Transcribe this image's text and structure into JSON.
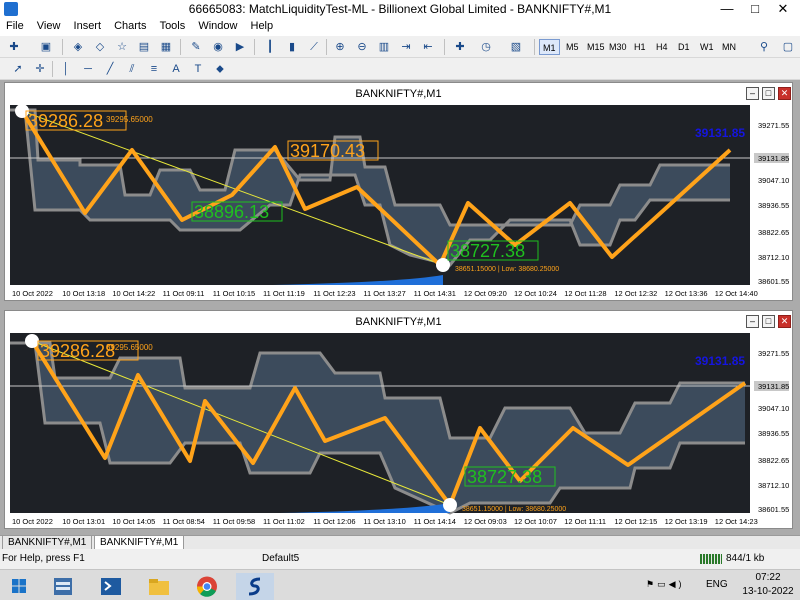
{
  "window": {
    "title": "66665083: MatchLiquidityTest-ML - Billionext Global Limited - BANKNIFTY#,M1",
    "minimize": "—",
    "maximize": "□",
    "close": "✕"
  },
  "menu": [
    "File",
    "View",
    "Insert",
    "Charts",
    "Tools",
    "Window",
    "Help"
  ],
  "timeframes": [
    "M1",
    "M5",
    "M15",
    "M30",
    "H1",
    "H4",
    "D1",
    "W1",
    "MN"
  ],
  "active_timeframe": "M1",
  "charts": [
    {
      "title": "BANKNIFTY#,M1",
      "header_info": "39295.65000",
      "current_price_label": "39131.85",
      "current_price_blue": "39131.85",
      "zigzag_labels": [
        "39286.28",
        "39170.43",
        "38896.13",
        "38727.38"
      ],
      "low_text": "38651.15000 | Low: 38680.25000",
      "y_ticks": [
        "39271.55",
        "39131.85",
        "39047.10",
        "38936.55",
        "38822.65",
        "38712.10",
        "38601.55"
      ],
      "x_ticks": [
        "10 Oct 2022",
        "10 Oct 13:18",
        "10 Oct 14:22",
        "11 Oct 09:11",
        "11 Oct 10:15",
        "11 Oct 11:19",
        "11 Oct 12:23",
        "11 Oct 13:27",
        "11 Oct 14:31",
        "12 Oct 09:20",
        "12 Oct 10:24",
        "12 Oct 11:28",
        "12 Oct 12:32",
        "12 Oct 13:36",
        "12 Oct 14:40"
      ]
    },
    {
      "title": "BANKNIFTY#,M1",
      "header_info": "39295.65000",
      "current_price_label": "39131.85",
      "current_price_blue": "39131.85",
      "zigzag_labels": [
        "39286.28",
        "38727.38"
      ],
      "low_text": "38651.15000 | Low: 38680.25000",
      "y_ticks": [
        "39271.55",
        "39131.85",
        "39047.10",
        "38936.55",
        "38822.65",
        "38712.10",
        "38601.55"
      ],
      "x_ticks": [
        "10 Oct 2022",
        "10 Oct 13:01",
        "10 Oct 14:05",
        "11 Oct 08:54",
        "11 Oct 09:58",
        "11 Oct 11:02",
        "11 Oct 12:06",
        "11 Oct 13:10",
        "11 Oct 14:14",
        "12 Oct 09:03",
        "12 Oct 10:07",
        "12 Oct 11:11",
        "12 Oct 12:15",
        "12 Oct 13:19",
        "12 Oct 14:23"
      ]
    }
  ],
  "tabs": [
    "BANKNIFTY#,M1",
    "BANKNIFTY#,M1"
  ],
  "status": {
    "help": "For Help, press F1",
    "profile": "Default5",
    "traffic": "844/1 kb"
  },
  "taskbar": {
    "lang": "ENG",
    "time": "07:22",
    "date": "13-10-2022"
  },
  "colors": {
    "chart_bg": "#1e2126",
    "zigzag": "#ffa31a",
    "band_fill": "#3c4b5c",
    "band_edge": "#8c8c8c",
    "label_green": "#1fc01f",
    "price_blue": "#1515e0"
  }
}
